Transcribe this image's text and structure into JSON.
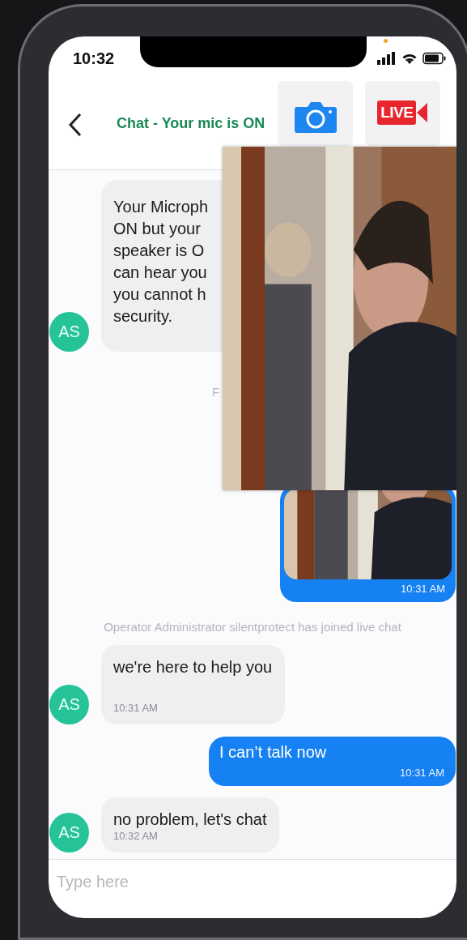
{
  "status_bar": {
    "time": "10:32"
  },
  "header": {
    "title": "Chat - Your mic is ON",
    "actions": [
      {
        "kind": "camera"
      },
      {
        "kind": "live",
        "label": "LIVE"
      }
    ]
  },
  "messages": [
    {
      "kind": "received",
      "avatar": "AS",
      "text": "Your Microph\nON but your\nspeaker is O\ncan hear you\nyou cannot h\nsecurity."
    },
    {
      "kind": "date",
      "text": "F"
    },
    {
      "kind": "sent_image",
      "time": "10:31 AM"
    },
    {
      "kind": "system",
      "text": "Operator Administrator silentprotect has joined live chat"
    },
    {
      "kind": "received",
      "avatar": "AS",
      "text": "we're here to help you",
      "time": "10:31 AM",
      "tall": true
    },
    {
      "kind": "sent",
      "text": "I can’t talk now",
      "time": "10:31 AM"
    },
    {
      "kind": "received",
      "avatar": "AS",
      "text": "no problem, let's chat",
      "time": "10:32 AM"
    }
  ],
  "input": {
    "placeholder": "Type here"
  }
}
